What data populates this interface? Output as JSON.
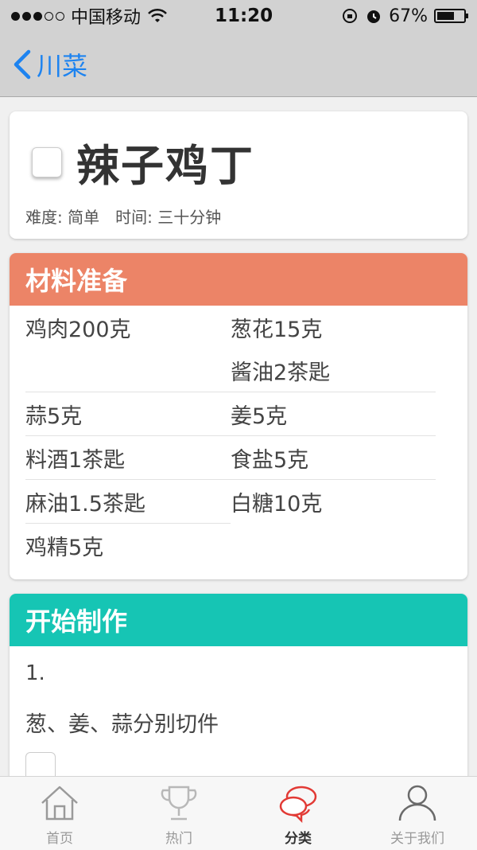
{
  "status_bar": {
    "carrier": "中国移动",
    "time": "11:20",
    "battery": "67%",
    "battery_level": 0.67
  },
  "nav": {
    "back_label": "川菜"
  },
  "recipe": {
    "title": "辣子鸡丁",
    "difficulty": "难度: 简单",
    "time": "时间: 三十分钟"
  },
  "ingredients": {
    "header": "材料准备",
    "header_color": "#ec8467",
    "rows": [
      {
        "left": [
          "鸡肉200克"
        ],
        "right": [
          "葱花15克",
          "酱油2茶匙"
        ]
      },
      {
        "left": [
          "蒜5克"
        ],
        "right": [
          "姜5克"
        ]
      },
      {
        "left": [
          "料酒1茶匙"
        ],
        "right": [
          "食盐5克"
        ]
      },
      {
        "left": [
          "麻油1.5茶匙"
        ],
        "right": [
          "白糖10克"
        ]
      },
      {
        "left": [
          "鸡精5克"
        ],
        "right": []
      }
    ]
  },
  "steps": {
    "header": "开始制作",
    "header_color": "#16c5b4",
    "items": [
      {
        "num": "1.",
        "text": "葱、姜、蒜分别切件"
      }
    ]
  },
  "tabs": [
    {
      "label": "首页",
      "icon": "home-icon"
    },
    {
      "label": "热门",
      "icon": "trophy-icon"
    },
    {
      "label": "分类",
      "icon": "chat-bubbles-icon",
      "active": true
    },
    {
      "label": "关于我们",
      "icon": "user-icon"
    }
  ]
}
